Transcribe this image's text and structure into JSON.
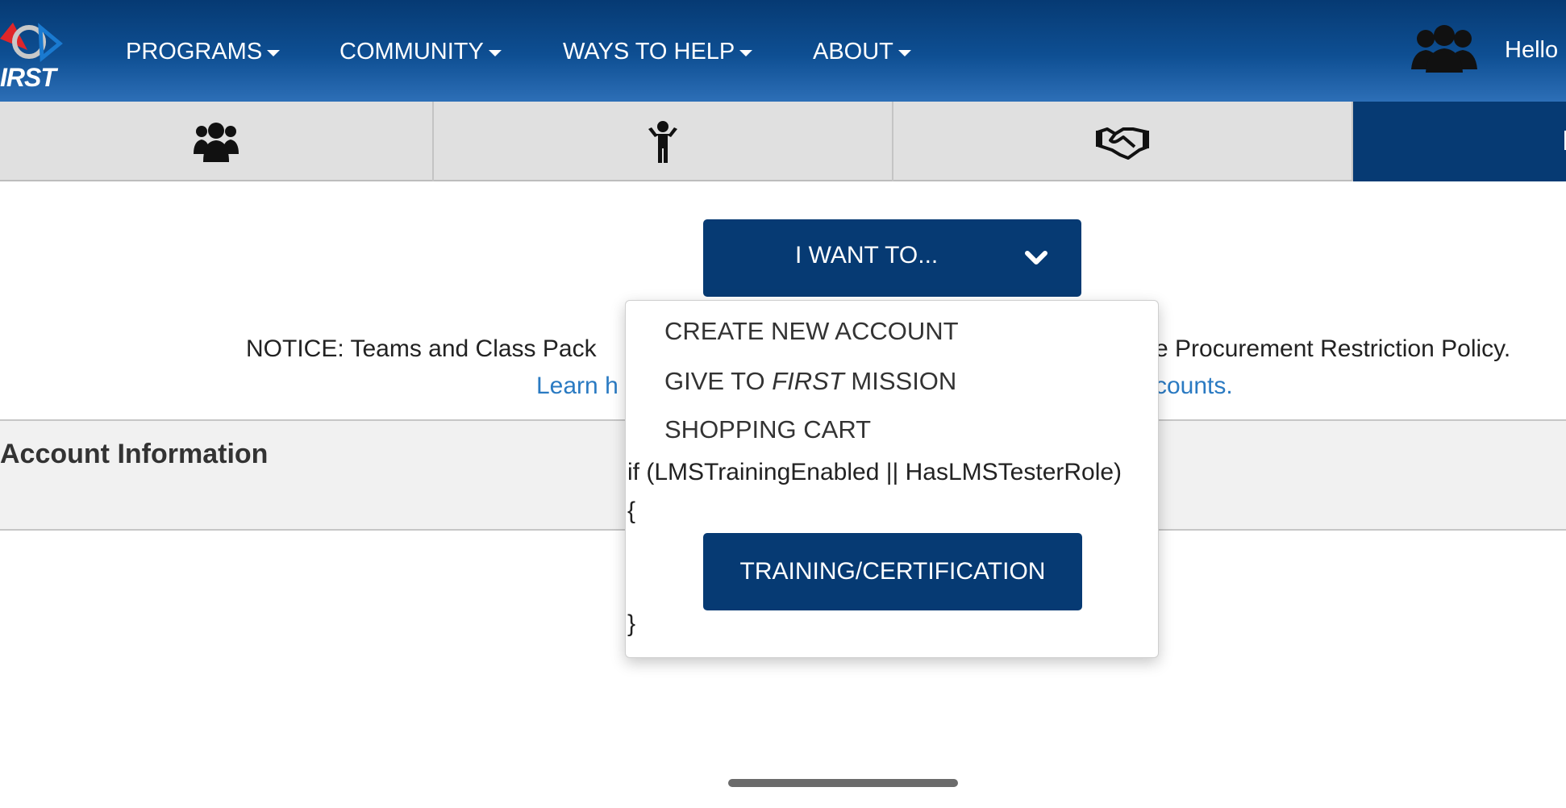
{
  "header": {
    "logo_text": "IRST",
    "nav": [
      {
        "label": "PROGRAMS"
      },
      {
        "label": "COMMUNITY"
      },
      {
        "label": "WAYS TO HELP"
      },
      {
        "label": "ABOUT"
      }
    ],
    "greeting": "Hello"
  },
  "tabs": [
    {
      "icon": "group-icon"
    },
    {
      "icon": "child-icon"
    },
    {
      "icon": "handshake-icon"
    },
    {
      "icon": "active-tab-icon"
    }
  ],
  "i_want_button": {
    "label": "I WANT TO...",
    "icon": "chevron-down-icon"
  },
  "notice": {
    "text_left": "NOTICE: Teams and Class Pack",
    "text_right": "e Procurement Restriction Policy.",
    "link_left": "Learn h",
    "link_right": "counts."
  },
  "account": {
    "title": "Account Information"
  },
  "dropdown": {
    "create_account": "CREATE NEW ACCOUNT",
    "give_prefix": "GIVE TO ",
    "give_emphasis": "FIRST",
    "give_suffix": " MISSION",
    "shopping_cart": "SHOPPING CART",
    "code_line": "if (LMSTrainingEnabled || HasLMSTesterRole)",
    "open_brace": "{",
    "training": "TRAINING/CERTIFICATION",
    "close_brace": "}"
  },
  "colors": {
    "brand_navy": "#063a73",
    "link_blue": "#2a7ac2",
    "tab_gray": "#e0e0e0"
  }
}
